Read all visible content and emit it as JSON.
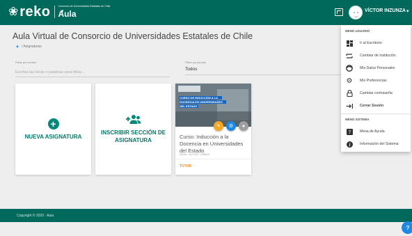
{
  "header": {
    "logo_mark": "❀",
    "logo_text": "reko",
    "org_small": "Consorcio de Universidades Estatales de Chile",
    "org_name": "Aula",
    "user_name": "VÍCTOR INZUNZA"
  },
  "page": {
    "title": "Aula Virtual de Consorcio de Universidades Estatales de Chile",
    "breadcrumb": "/ Asignaturas"
  },
  "filters": {
    "name_label": "Filtrar por nombre",
    "name_placeholder": "Escriba las letras o palabras para filtrar...",
    "period_label": "Filtrar por periodo",
    "period_value": "Todos"
  },
  "cards": {
    "new_subject": "NUEVA ASIGNATURA",
    "enroll_section": "INSCRIBIR SECCIÓN DE ASIGNATURA"
  },
  "course": {
    "banner_text": "CURSO DE INDUCCIÓN A LA DOCENCIA EN UNIVERSIDADES DEL ESTADO",
    "description": "Curso: Inducción a la Docencia en Universidades del Estado",
    "meta": "2020/1 - ACTIVO - VISIBLE",
    "role": "TUTOR"
  },
  "menu": {
    "user_section": "MENÚ USUARIO",
    "system_section": "MENÚ SISTEMA",
    "user_items": [
      {
        "label": "Ir al Escritorio",
        "icon": "dashboard-icon"
      },
      {
        "label": "Cambiar de Institución",
        "icon": "swap-icon"
      },
      {
        "label": "Mis Datos Personales",
        "icon": "face-icon"
      },
      {
        "label": "Mis Preferencias",
        "icon": "gear-icon"
      },
      {
        "label": "Cambiar contraseña",
        "icon": "lock-icon"
      },
      {
        "label": "Cerrar Sesión",
        "icon": "logout-icon"
      }
    ],
    "system_items": [
      {
        "label": "Mesa de Ayuda",
        "icon": "help-icon"
      },
      {
        "label": "Información del Sistema",
        "icon": "info-icon"
      }
    ]
  },
  "footer": {
    "copyright": "Copyright © 2020 · Aula"
  },
  "colors": {
    "primary": "#00695c",
    "accent": "#00897b",
    "link_blue": "#1e88e5",
    "tutor_orange": "#ef8c2e"
  }
}
